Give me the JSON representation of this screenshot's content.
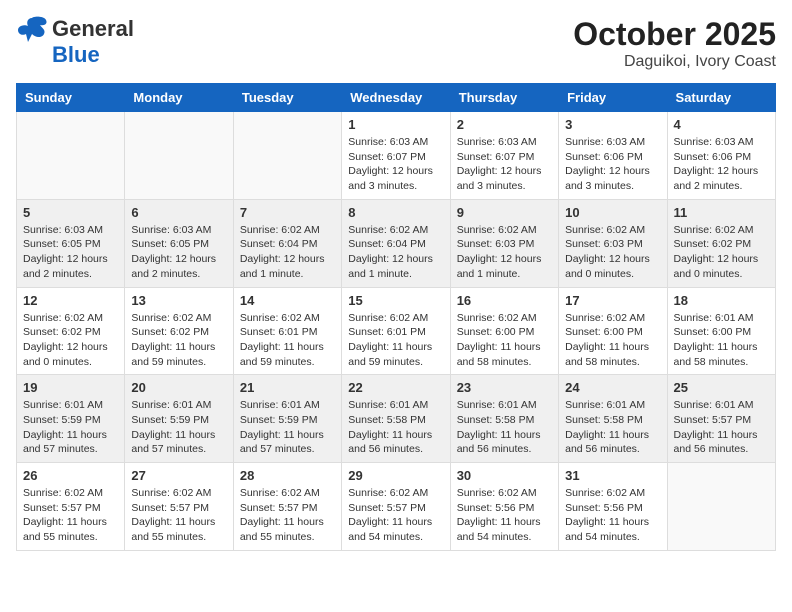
{
  "header": {
    "logo_general": "General",
    "logo_blue": "Blue",
    "title": "October 2025",
    "subtitle": "Daguikoi, Ivory Coast"
  },
  "days_of_week": [
    "Sunday",
    "Monday",
    "Tuesday",
    "Wednesday",
    "Thursday",
    "Friday",
    "Saturday"
  ],
  "weeks": [
    {
      "shade": false,
      "days": [
        {
          "num": "",
          "info": ""
        },
        {
          "num": "",
          "info": ""
        },
        {
          "num": "",
          "info": ""
        },
        {
          "num": "1",
          "info": "Sunrise: 6:03 AM\nSunset: 6:07 PM\nDaylight: 12 hours\nand 3 minutes."
        },
        {
          "num": "2",
          "info": "Sunrise: 6:03 AM\nSunset: 6:07 PM\nDaylight: 12 hours\nand 3 minutes."
        },
        {
          "num": "3",
          "info": "Sunrise: 6:03 AM\nSunset: 6:06 PM\nDaylight: 12 hours\nand 3 minutes."
        },
        {
          "num": "4",
          "info": "Sunrise: 6:03 AM\nSunset: 6:06 PM\nDaylight: 12 hours\nand 2 minutes."
        }
      ]
    },
    {
      "shade": true,
      "days": [
        {
          "num": "5",
          "info": "Sunrise: 6:03 AM\nSunset: 6:05 PM\nDaylight: 12 hours\nand 2 minutes."
        },
        {
          "num": "6",
          "info": "Sunrise: 6:03 AM\nSunset: 6:05 PM\nDaylight: 12 hours\nand 2 minutes."
        },
        {
          "num": "7",
          "info": "Sunrise: 6:02 AM\nSunset: 6:04 PM\nDaylight: 12 hours\nand 1 minute."
        },
        {
          "num": "8",
          "info": "Sunrise: 6:02 AM\nSunset: 6:04 PM\nDaylight: 12 hours\nand 1 minute."
        },
        {
          "num": "9",
          "info": "Sunrise: 6:02 AM\nSunset: 6:03 PM\nDaylight: 12 hours\nand 1 minute."
        },
        {
          "num": "10",
          "info": "Sunrise: 6:02 AM\nSunset: 6:03 PM\nDaylight: 12 hours\nand 0 minutes."
        },
        {
          "num": "11",
          "info": "Sunrise: 6:02 AM\nSunset: 6:02 PM\nDaylight: 12 hours\nand 0 minutes."
        }
      ]
    },
    {
      "shade": false,
      "days": [
        {
          "num": "12",
          "info": "Sunrise: 6:02 AM\nSunset: 6:02 PM\nDaylight: 12 hours\nand 0 minutes."
        },
        {
          "num": "13",
          "info": "Sunrise: 6:02 AM\nSunset: 6:02 PM\nDaylight: 11 hours\nand 59 minutes."
        },
        {
          "num": "14",
          "info": "Sunrise: 6:02 AM\nSunset: 6:01 PM\nDaylight: 11 hours\nand 59 minutes."
        },
        {
          "num": "15",
          "info": "Sunrise: 6:02 AM\nSunset: 6:01 PM\nDaylight: 11 hours\nand 59 minutes."
        },
        {
          "num": "16",
          "info": "Sunrise: 6:02 AM\nSunset: 6:00 PM\nDaylight: 11 hours\nand 58 minutes."
        },
        {
          "num": "17",
          "info": "Sunrise: 6:02 AM\nSunset: 6:00 PM\nDaylight: 11 hours\nand 58 minutes."
        },
        {
          "num": "18",
          "info": "Sunrise: 6:01 AM\nSunset: 6:00 PM\nDaylight: 11 hours\nand 58 minutes."
        }
      ]
    },
    {
      "shade": true,
      "days": [
        {
          "num": "19",
          "info": "Sunrise: 6:01 AM\nSunset: 5:59 PM\nDaylight: 11 hours\nand 57 minutes."
        },
        {
          "num": "20",
          "info": "Sunrise: 6:01 AM\nSunset: 5:59 PM\nDaylight: 11 hours\nand 57 minutes."
        },
        {
          "num": "21",
          "info": "Sunrise: 6:01 AM\nSunset: 5:59 PM\nDaylight: 11 hours\nand 57 minutes."
        },
        {
          "num": "22",
          "info": "Sunrise: 6:01 AM\nSunset: 5:58 PM\nDaylight: 11 hours\nand 56 minutes."
        },
        {
          "num": "23",
          "info": "Sunrise: 6:01 AM\nSunset: 5:58 PM\nDaylight: 11 hours\nand 56 minutes."
        },
        {
          "num": "24",
          "info": "Sunrise: 6:01 AM\nSunset: 5:58 PM\nDaylight: 11 hours\nand 56 minutes."
        },
        {
          "num": "25",
          "info": "Sunrise: 6:01 AM\nSunset: 5:57 PM\nDaylight: 11 hours\nand 56 minutes."
        }
      ]
    },
    {
      "shade": false,
      "days": [
        {
          "num": "26",
          "info": "Sunrise: 6:02 AM\nSunset: 5:57 PM\nDaylight: 11 hours\nand 55 minutes."
        },
        {
          "num": "27",
          "info": "Sunrise: 6:02 AM\nSunset: 5:57 PM\nDaylight: 11 hours\nand 55 minutes."
        },
        {
          "num": "28",
          "info": "Sunrise: 6:02 AM\nSunset: 5:57 PM\nDaylight: 11 hours\nand 55 minutes."
        },
        {
          "num": "29",
          "info": "Sunrise: 6:02 AM\nSunset: 5:57 PM\nDaylight: 11 hours\nand 54 minutes."
        },
        {
          "num": "30",
          "info": "Sunrise: 6:02 AM\nSunset: 5:56 PM\nDaylight: 11 hours\nand 54 minutes."
        },
        {
          "num": "31",
          "info": "Sunrise: 6:02 AM\nSunset: 5:56 PM\nDaylight: 11 hours\nand 54 minutes."
        },
        {
          "num": "",
          "info": ""
        }
      ]
    }
  ]
}
